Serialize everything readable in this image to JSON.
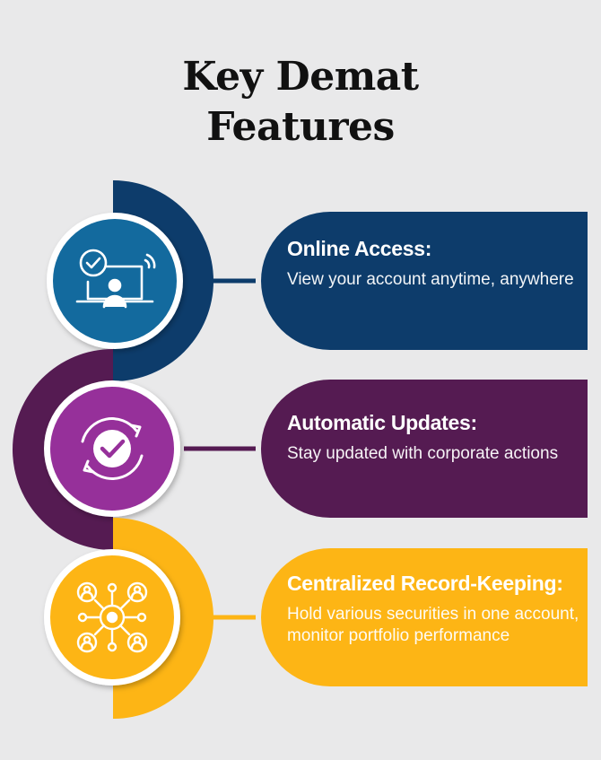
{
  "title": {
    "line1": "Key Demat",
    "line2": "Features"
  },
  "colors": {
    "background": "#e9e9ea",
    "navy": "#0d3c6b",
    "blue": "#136a9e",
    "plum": "#551b52",
    "purple": "#96309a",
    "amber": "#fdb515"
  },
  "features": [
    {
      "title": "Online Access:",
      "description": "View your account anytime, anywhere",
      "icon": "laptop-user-check-icon"
    },
    {
      "title": "Automatic Updates:",
      "description": "Stay updated with corporate actions",
      "icon": "refresh-check-icon"
    },
    {
      "title": "Centralized Record-Keeping:",
      "description": "Hold various securities in one account, monitor portfolio performance",
      "icon": "network-hub-icon"
    }
  ]
}
